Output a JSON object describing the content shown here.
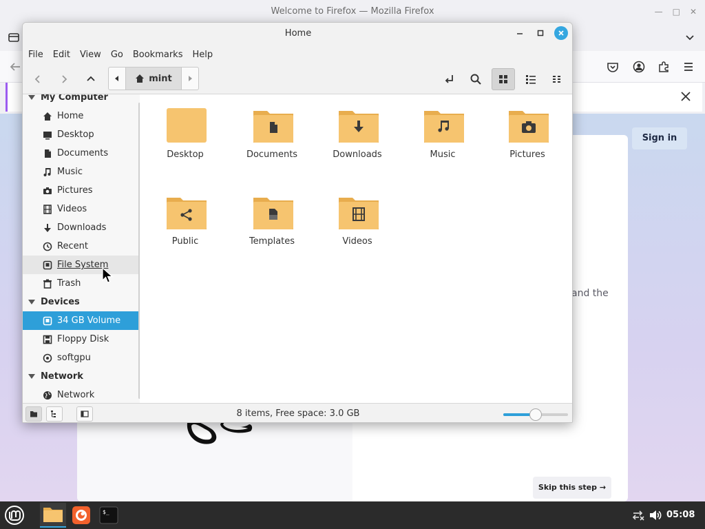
{
  "firefox": {
    "window_title": "Welcome to Firefox — Mozilla Firefox",
    "signin_label": "Sign in",
    "partial_text": "and the",
    "skip_label": "Skip this step →"
  },
  "nemo": {
    "title": "Home",
    "menu": [
      "File",
      "Edit",
      "View",
      "Go",
      "Bookmarks",
      "Help"
    ],
    "path_crumb": "mint",
    "sidebar": {
      "sections": [
        {
          "label": "My Computer",
          "items": [
            {
              "label": "Home",
              "icon": "home-icon"
            },
            {
              "label": "Desktop",
              "icon": "desktop-icon"
            },
            {
              "label": "Documents",
              "icon": "document-icon"
            },
            {
              "label": "Music",
              "icon": "music-icon"
            },
            {
              "label": "Pictures",
              "icon": "camera-icon"
            },
            {
              "label": "Videos",
              "icon": "film-icon"
            },
            {
              "label": "Downloads",
              "icon": "download-icon"
            },
            {
              "label": "Recent",
              "icon": "clock-icon"
            },
            {
              "label": "File System",
              "icon": "drive-icon",
              "state": "hover"
            },
            {
              "label": "Trash",
              "icon": "trash-icon"
            }
          ]
        },
        {
          "label": "Devices",
          "items": [
            {
              "label": "34 GB Volume",
              "icon": "drive-icon",
              "state": "selected"
            },
            {
              "label": "Floppy Disk",
              "icon": "floppy-icon"
            },
            {
              "label": "softgpu",
              "icon": "disc-icon"
            }
          ]
        },
        {
          "label": "Network",
          "items": [
            {
              "label": "Network",
              "icon": "globe-icon"
            }
          ]
        }
      ]
    },
    "files": [
      {
        "name": "Desktop",
        "emblem": "none"
      },
      {
        "name": "Documents",
        "emblem": "document"
      },
      {
        "name": "Downloads",
        "emblem": "download"
      },
      {
        "name": "Music",
        "emblem": "music"
      },
      {
        "name": "Pictures",
        "emblem": "camera"
      },
      {
        "name": "Public",
        "emblem": "share"
      },
      {
        "name": "Templates",
        "emblem": "template"
      },
      {
        "name": "Videos",
        "emblem": "film"
      }
    ],
    "status_text": "8 items, Free space: 3.0 GB",
    "zoom_level": 0.5
  },
  "taskbar": {
    "clock": "05:08",
    "apps": [
      "menu-icon",
      "files-icon",
      "firefox-icon",
      "terminal-icon"
    ]
  },
  "colors": {
    "accent": "#2e9fd9",
    "folder_body": "#f6c46f",
    "folder_tab": "#e8ad4e",
    "emblem": "#3a3a3a"
  }
}
